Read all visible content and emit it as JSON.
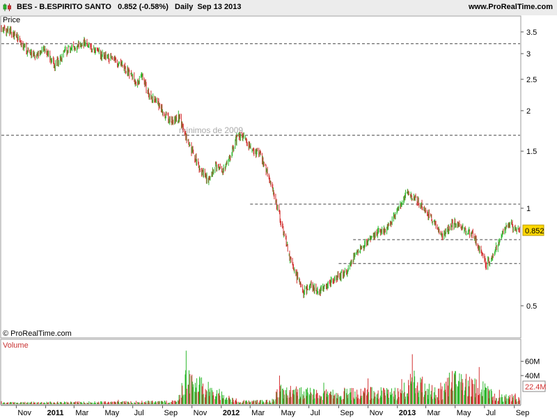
{
  "header": {
    "ticker": "BES",
    "name": "B.ESPIRITO SANTO",
    "last": "0.852",
    "change": "(-0.58%)",
    "period": "Daily",
    "date": "Sep 13 2013",
    "brand": "www.ProRealTime.com"
  },
  "copyright": "© ProRealTime.com",
  "colors": {
    "up": "#2db82d",
    "down": "#d23232",
    "level_line": "#444444",
    "price_badge": "#ffd700"
  },
  "chart_data": [
    {
      "type": "line",
      "title": "Price",
      "price_label": "0.852",
      "annotation": "mínimos de 2009",
      "y_scale": "log",
      "ylim": [
        0.4,
        3.9
      ],
      "yticks": [
        "3.5",
        "3",
        "2.5",
        "2",
        "1.5",
        "1",
        "0.5"
      ],
      "ytick_values": [
        3.5,
        3,
        2.5,
        2,
        1.5,
        1,
        0.5
      ],
      "x_tick_labels": [
        "Nov",
        "2011",
        "Mar",
        "May",
        "Jul",
        "Sep",
        "Nov",
        "2012",
        "Mar",
        "May",
        "Jul",
        "Sep",
        "Nov",
        "2013",
        "Mar",
        "May",
        "Jul",
        "Sep"
      ],
      "x_tick_dates": [
        "2010-11-01",
        "2011-01-01",
        "2011-03-01",
        "2011-05-01",
        "2011-07-01",
        "2011-09-01",
        "2011-11-01",
        "2012-01-01",
        "2012-03-01",
        "2012-05-01",
        "2012-07-01",
        "2012-09-01",
        "2012-11-01",
        "2013-01-01",
        "2013-03-01",
        "2013-05-01",
        "2013-07-01",
        "2013-09-01"
      ],
      "x_range": [
        "2010-10-01",
        "2013-09-13"
      ],
      "levels": [
        {
          "value": 3.22,
          "from": "2010-10-01",
          "to": "2013-09-13"
        },
        {
          "value": 1.68,
          "from": "2010-10-01",
          "to": "2013-09-13"
        },
        {
          "value": 1.03,
          "from": "2012-03-01",
          "to": "2013-09-13"
        },
        {
          "value": 0.8,
          "from": "2012-10-01",
          "to": "2013-09-13"
        },
        {
          "value": 0.675,
          "from": "2012-09-01",
          "to": "2013-09-13"
        }
      ],
      "series": [
        {
          "x": [
            "2010-10-01",
            "2010-10-20",
            "2010-11-05",
            "2010-11-25",
            "2010-12-10",
            "2011-01-01",
            "2011-01-20",
            "2011-02-10",
            "2011-03-01",
            "2011-03-20",
            "2011-04-10",
            "2011-05-01",
            "2011-05-20",
            "2011-06-10",
            "2011-06-25",
            "2011-07-10",
            "2011-07-20",
            "2011-08-05",
            "2011-08-20",
            "2011-09-05",
            "2011-09-20",
            "2011-10-05",
            "2011-10-20",
            "2011-11-05",
            "2011-11-20",
            "2011-12-05",
            "2011-12-20",
            "2012-01-05",
            "2012-01-20",
            "2012-02-05",
            "2012-02-20",
            "2012-03-05",
            "2012-03-20",
            "2012-04-05",
            "2012-04-20",
            "2012-05-05",
            "2012-05-20",
            "2012-06-05",
            "2012-06-20",
            "2012-07-05",
            "2012-07-20",
            "2012-08-05",
            "2012-08-20",
            "2012-09-05",
            "2012-09-20",
            "2012-10-05",
            "2012-10-20",
            "2012-11-05",
            "2012-11-20",
            "2012-12-05",
            "2012-12-20",
            "2013-01-05",
            "2013-01-20",
            "2013-02-05",
            "2013-02-20",
            "2013-03-05",
            "2013-03-20",
            "2013-04-05",
            "2013-04-20",
            "2013-05-05",
            "2013-05-20",
            "2013-06-05",
            "2013-06-20",
            "2013-07-05",
            "2013-07-20",
            "2013-08-05",
            "2013-08-20",
            "2013-09-05",
            "2013-09-13"
          ],
          "y": [
            3.6,
            3.5,
            3.3,
            3.05,
            2.95,
            3.1,
            2.75,
            3.05,
            3.15,
            3.25,
            3.1,
            2.95,
            2.9,
            2.75,
            2.6,
            2.4,
            2.55,
            2.2,
            2.15,
            1.95,
            1.85,
            1.92,
            1.65,
            1.45,
            1.3,
            1.22,
            1.35,
            1.3,
            1.45,
            1.68,
            1.65,
            1.5,
            1.48,
            1.3,
            1.1,
            0.9,
            0.72,
            0.62,
            0.55,
            0.58,
            0.55,
            0.58,
            0.6,
            0.62,
            0.64,
            0.72,
            0.76,
            0.8,
            0.84,
            0.86,
            0.9,
            1.02,
            1.12,
            1.08,
            1.02,
            0.96,
            0.9,
            0.82,
            0.88,
            0.9,
            0.85,
            0.84,
            0.75,
            0.67,
            0.72,
            0.82,
            0.9,
            0.86,
            0.852
          ]
        }
      ]
    },
    {
      "type": "bar",
      "title": "Volume",
      "volume_label": "22.4M",
      "yticks": [
        "60M",
        "40M"
      ],
      "ytick_values": [
        60,
        40
      ],
      "ylim": [
        0,
        90
      ],
      "unit": "millions",
      "series": [
        {
          "x": [
            "2010-10-01",
            "2011-01-01",
            "2011-06-01",
            "2011-10-01",
            "2011-10-20",
            "2012-02-01",
            "2012-04-15",
            "2012-05-01",
            "2012-08-01",
            "2012-11-01",
            "2013-01-10",
            "2013-02-01",
            "2013-04-01",
            "2013-04-20",
            "2013-06-20",
            "2013-08-01",
            "2013-09-13"
          ],
          "values": [
            4,
            5,
            6,
            8,
            75,
            8,
            9,
            40,
            30,
            36,
            35,
            70,
            30,
            72,
            52,
            20,
            22.4
          ]
        }
      ]
    }
  ]
}
